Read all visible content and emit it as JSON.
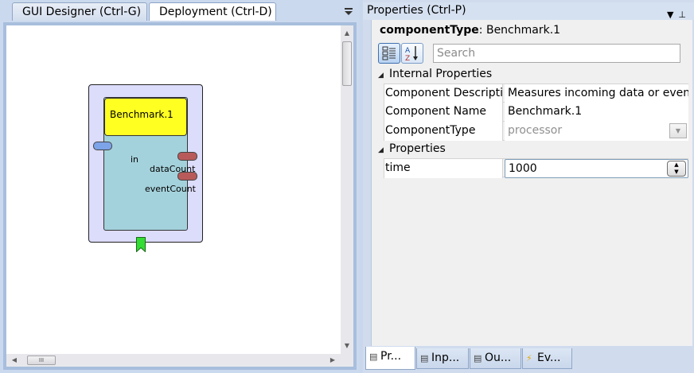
{
  "left_panel": {
    "tabs": [
      {
        "label": "GUI Designer (Ctrl-G)"
      },
      {
        "label": "Deployment (Ctrl-D)"
      }
    ],
    "component": {
      "title": "Benchmark.1",
      "input_ports": [
        "in"
      ],
      "output_ports": [
        "dataCount",
        "eventCount"
      ]
    },
    "hscroll_grip": "III"
  },
  "properties": {
    "header": "Properties (Ctrl-P)",
    "component_type_label": "componentType",
    "component_type_value": "Benchmark.1",
    "search_placeholder": "Search",
    "sections": [
      {
        "title": "Internal Properties",
        "rows": [
          {
            "name": "Component Descriptic",
            "value": "Measures incoming data or events"
          },
          {
            "name": "Component Name",
            "value": "Benchmark.1"
          },
          {
            "name": "ComponentType",
            "value": "processor"
          }
        ]
      },
      {
        "title": "Properties",
        "rows": [
          {
            "name": "time",
            "value": "1000"
          }
        ]
      }
    ],
    "bottom_tabs": [
      {
        "label": "Pr..."
      },
      {
        "label": "Inp..."
      },
      {
        "label": "Ou..."
      },
      {
        "label": "Ev..."
      }
    ]
  },
  "colors": {
    "component_outer": "#dcdcfb",
    "component_body": "#a4d2dc",
    "component_title": "#ffff22",
    "input_port": "#7da3e8",
    "output_port": "#b85a5a",
    "bookmark": "#33dd33"
  }
}
